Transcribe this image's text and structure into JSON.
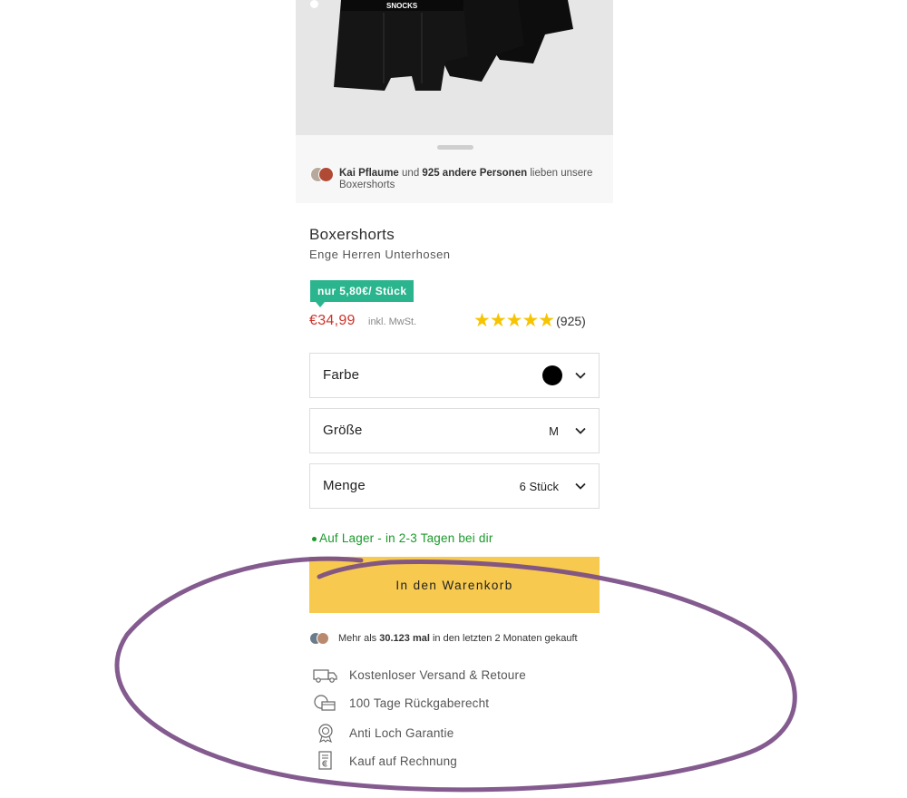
{
  "hero": {
    "brand_text": "SNOCKS"
  },
  "social": {
    "name": "Kai Pflaume",
    "connector": "und",
    "count": "925 andere Personen",
    "rest": "lieben unsere Boxershorts"
  },
  "product": {
    "title": "Boxershorts",
    "subtitle": "Enge Herren Unterhosen",
    "unit_badge": "nur 5,80€/ Stück",
    "price": "€34,99",
    "tax_note": "inkl. MwSt.",
    "stars": "★★★★★",
    "rating_count": "(925)"
  },
  "options": {
    "color_label": "Farbe",
    "color_value": "#000000",
    "size_label": "Größe",
    "size_value": "M",
    "qty_label": "Menge",
    "qty_value": "6 Stück"
  },
  "stock_text": "Auf Lager - in 2-3 Tagen bei dir",
  "cart_button": "In den Warenkorb",
  "purchase_proof": {
    "prefix": "Mehr als",
    "count": "30.123 mal",
    "suffix": "in den letzten 2 Monaten gekauft"
  },
  "features": [
    {
      "icon": "truck-icon",
      "label": "Kostenloser Versand & Retoure"
    },
    {
      "icon": "return-box-icon",
      "label": "100 Tage Rückgaberecht"
    },
    {
      "icon": "guarantee-seal-icon",
      "label": "Anti Loch Garantie"
    },
    {
      "icon": "invoice-icon",
      "label": "Kauf auf Rechnung"
    }
  ],
  "colors": {
    "badge": "#2bb58e",
    "price": "#d0332b",
    "stars": "#f6c400",
    "stock": "#1a9a2a",
    "cart_button": "#f7c94f",
    "annotation": "#7a4d86"
  }
}
